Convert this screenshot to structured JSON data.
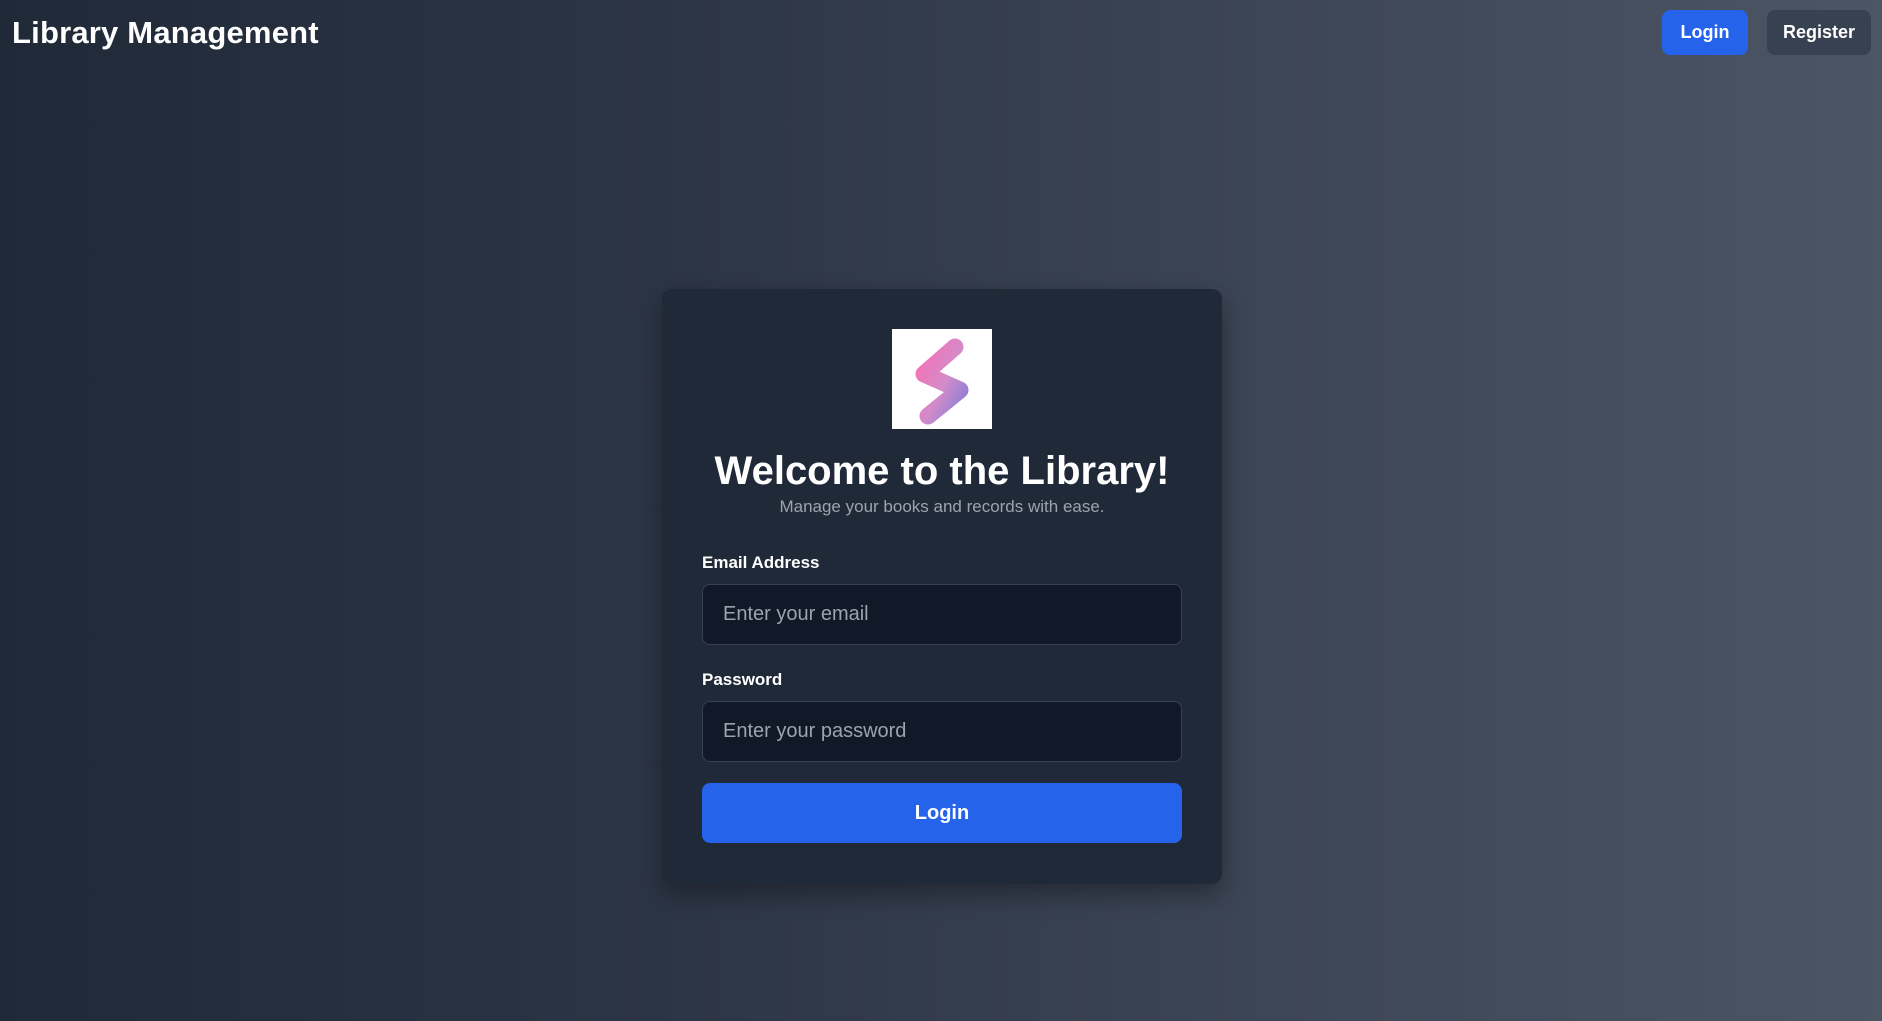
{
  "navbar": {
    "brand": "Library Management",
    "login_label": "Login",
    "register_label": "Register"
  },
  "card": {
    "logo_icon": "s-logo-icon",
    "title": "Welcome to the Library!",
    "subtitle": "Manage your books and records with ease.",
    "email_label": "Email Address",
    "email_placeholder": "Enter your email",
    "email_value": "",
    "password_label": "Password",
    "password_placeholder": "Enter your password",
    "password_value": "",
    "submit_label": "Login"
  },
  "colors": {
    "primary": "#2563eb",
    "card_bg": "#1f2937",
    "input_bg": "#111827",
    "secondary_button": "#374151",
    "muted_text": "#9ca3af",
    "logo_gradient_start": "#f472b6",
    "logo_gradient_end": "#8b7fd6"
  }
}
